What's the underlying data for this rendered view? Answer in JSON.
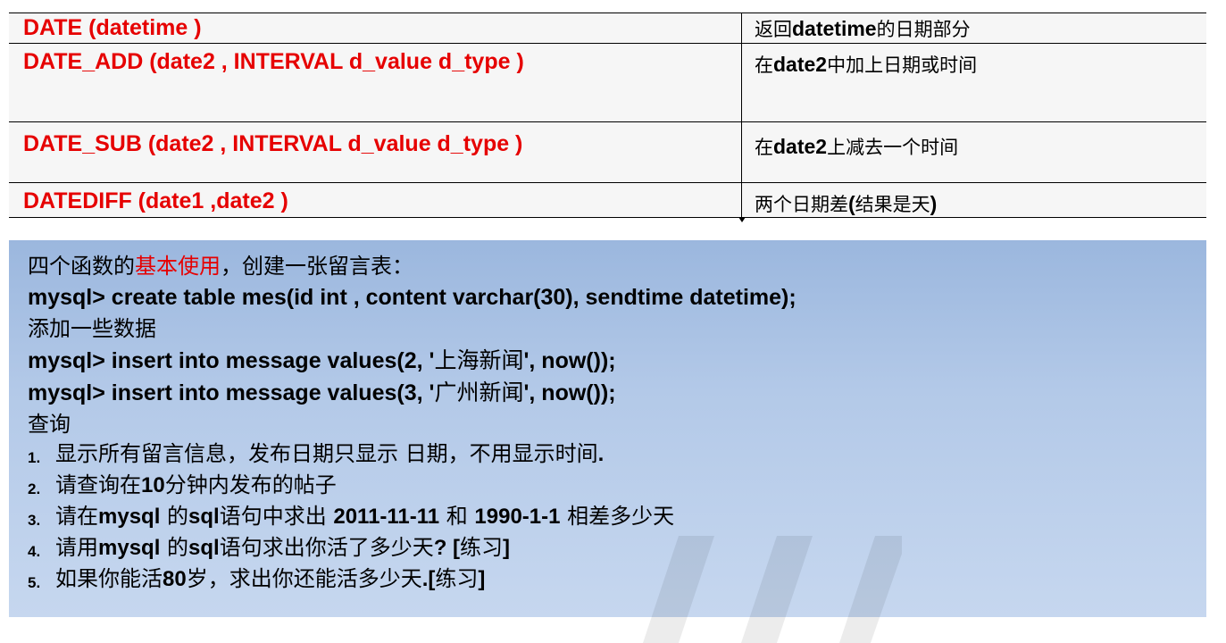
{
  "table": {
    "rows": [
      {
        "fn": "DATE (datetime )",
        "desc_pre": "返回",
        "desc_bold": "datetime",
        "desc_post": "的日期部分"
      },
      {
        "fn": "DATE_ADD (date2 , INTERVAL d_value d_type )",
        "desc_pre": "在",
        "desc_bold": "date2",
        "desc_post": "中加上日期或时间"
      },
      {
        "fn": "DATE_SUB (date2 , INTERVAL d_value d_type )",
        "desc_pre": "在",
        "desc_bold": "date2",
        "desc_post": "上减去一个时间"
      },
      {
        "fn": "DATEDIFF (date1 ,date2 )",
        "desc_pre": "两个日期差",
        "desc_bold": "(",
        "desc_post": "结果是天",
        "desc_bold2": ")"
      }
    ]
  },
  "panel": {
    "intro_pre": "四个函数的",
    "intro_red": "基本使用",
    "intro_post": "，创建一张留言表：",
    "create_sql": "mysql> create table mes(id int , content varchar(30), sendtime datetime);",
    "add_label": "添加一些数据",
    "insert1_pre": "mysql> insert into message values(2, '",
    "insert1_cn": "上海新闻",
    "insert1_post": "', now());",
    "insert2_pre": "mysql> insert into message values(3, '",
    "insert2_cn": "广州新闻",
    "insert2_post": "', now());",
    "query_label": "查询",
    "items": [
      {
        "num": "1.",
        "parts": [
          "显示所有留言信息，发布日期只显示 日期，不用显示时间",
          "."
        ]
      },
      {
        "num": "2.",
        "parts": [
          "请查询在",
          "10",
          "分钟内发布的帖子"
        ]
      },
      {
        "num": "3.",
        "parts": [
          "请在",
          "mysql",
          " 的",
          "sql",
          "语句中求出 ",
          "2011-11-11",
          " 和 ",
          "1990-1-1",
          " 相差多少天"
        ]
      },
      {
        "num": "4.",
        "parts": [
          "请用",
          "mysql",
          " 的",
          "sql",
          "语句求出你活了多少天",
          "? [",
          "练习",
          "]"
        ]
      },
      {
        "num": "5.",
        "parts": [
          "如果你能活",
          "80",
          "岁，求出你还能活多少天",
          ".[",
          "练习",
          "]"
        ]
      }
    ]
  }
}
